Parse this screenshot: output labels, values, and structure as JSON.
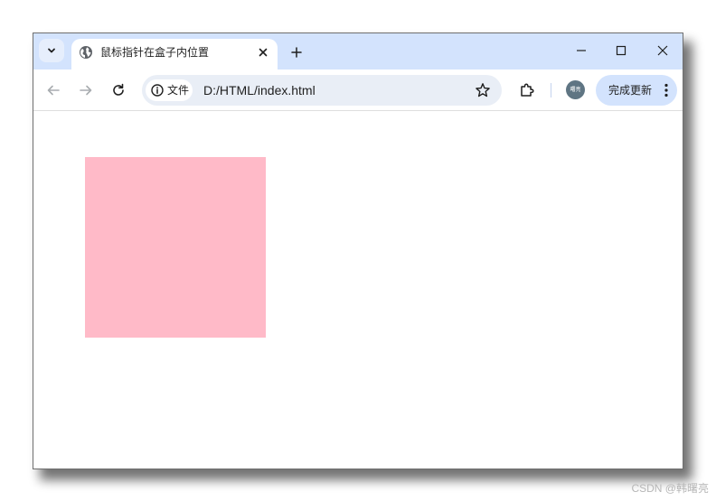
{
  "tab": {
    "title": "鼠标指针在盒子内位置"
  },
  "address_bar": {
    "site_chip_label": "文件",
    "url": "D:/HTML/index.html"
  },
  "profile": {
    "avatar_text": "曙亮"
  },
  "update_button": {
    "label": "完成更新"
  },
  "page": {
    "box_color": "#ffbac8"
  },
  "watermark": {
    "text": "CSDN @韩曙亮"
  },
  "colors": {
    "tabstrip": "#d3e3fd",
    "omnibox": "#e9eef6",
    "update_button": "#d3e3fd"
  },
  "icons": [
    "tab-search-chevron-icon",
    "globe-icon",
    "close-icon",
    "plus-icon",
    "minimize-icon",
    "maximize-icon",
    "window-close-icon",
    "back-arrow-icon",
    "forward-arrow-icon",
    "reload-icon",
    "info-icon",
    "star-icon",
    "extension-puzzle-icon",
    "more-vert-icon"
  ]
}
